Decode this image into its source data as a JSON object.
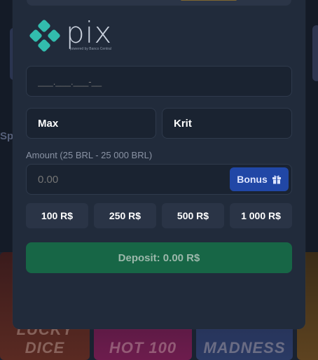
{
  "background": {
    "left_label": "Sp",
    "tiles": [
      "LUCKY DICE",
      "HOT 100",
      "MADNESS",
      ""
    ]
  },
  "pix": {
    "brand": "pix",
    "powered_by": "powered by Banco Central"
  },
  "form": {
    "cpf_placeholder": "___.___.___-__",
    "first_name": "Max",
    "last_name": "Krit",
    "amount_label": "Amount (25 BRL - 25 000 BRL)",
    "amount_placeholder": "0.00",
    "bonus_label": "Bonus"
  },
  "presets": [
    "100 R$",
    "250 R$",
    "500 R$",
    "1 000 R$"
  ],
  "deposit_label": "Deposit: 0.00 R$",
  "colors": {
    "modal_bg": "#212b3b",
    "input_bg": "#1a2331",
    "bonus": "#2147a6",
    "deposit": "#176646",
    "pix_teal": "#32bcad"
  }
}
